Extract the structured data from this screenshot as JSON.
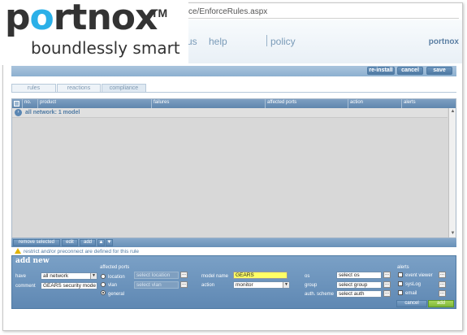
{
  "browser": {
    "url_fragment": "ce/EnforceRules.aspx"
  },
  "logo": {
    "word_prefix": "p",
    "word_o": "o",
    "word_suffix": "rtnox",
    "tm": "TM",
    "tagline": "boundlessly smart"
  },
  "topnav": {
    "items": [
      "us",
      "help",
      "policy"
    ],
    "brand": "portnox"
  },
  "toolbar": {
    "reinstall": "re-install",
    "cancel": "cancel",
    "save": "save"
  },
  "tabs": [
    "rules",
    "reactions",
    "compliance"
  ],
  "table": {
    "columns": [
      "no.",
      "product",
      "failures",
      "affected ports",
      "action",
      "alerts"
    ],
    "group_label": "all network: 1 model"
  },
  "footer": {
    "remove_selected": "remove selected",
    "edit": "edit",
    "add": "add"
  },
  "warning": "restrict and/or preconnect are defined for this rule",
  "add_new": {
    "title": "add new",
    "have_label": "have",
    "have_value": "all network",
    "comment_label": "comment",
    "comment_value": "GEARS security mode",
    "affected_ports_label": "affected ports",
    "radio_location": "location",
    "radio_vlan": "vlan",
    "radio_general": "general",
    "select_location": "select location",
    "select_vlan": "select vlan",
    "model_name_label": "model name",
    "model_name_value": "GEARS",
    "action_label": "action",
    "action_value": "monitor",
    "os_label": "os",
    "os_value": "select os",
    "group_label": "group",
    "group_value": "select group",
    "auth_label": "auth. scheme",
    "auth_value": "select auth",
    "alerts_label": "alerts",
    "alert_event_viewer": "event viewer",
    "alert_syslog": "sysLog",
    "alert_email": "email",
    "cancel": "cancel",
    "add": "add"
  }
}
